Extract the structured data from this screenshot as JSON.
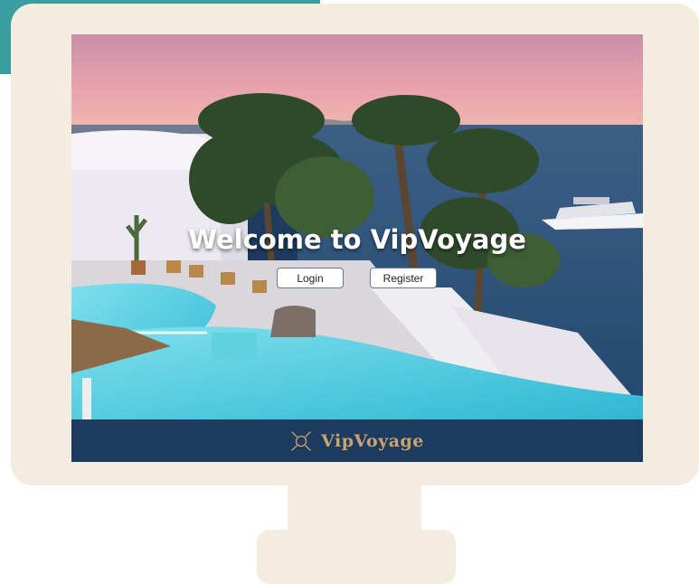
{
  "hero": {
    "title": "Welcome to VipVoyage",
    "login_label": "Login",
    "register_label": "Register"
  },
  "footer": {
    "brand": "VipVoyage",
    "logo_icon": "compass-sun-icon"
  },
  "colors": {
    "accent_teal": "#3a9ea0",
    "monitor_frame": "#f5ece0",
    "footer_bg": "#1d3a5f",
    "brand_gold": "#c8a472"
  }
}
